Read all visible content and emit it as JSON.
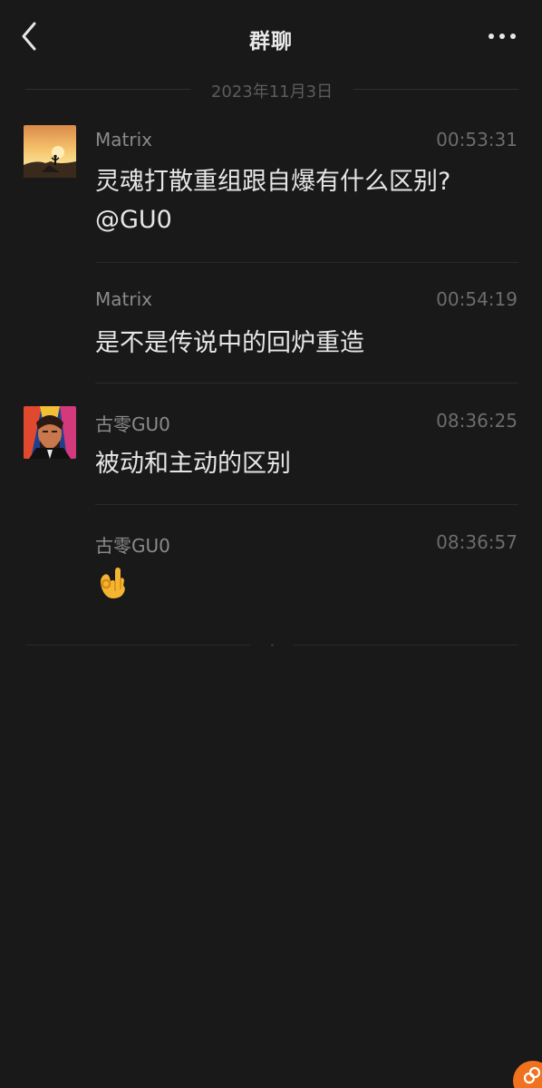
{
  "header": {
    "title": "群聊"
  },
  "date_separator": "2023年11月3日",
  "messages": [
    {
      "sender": "Matrix",
      "time": "00:53:31",
      "text_line1": "灵魂打散重组跟自爆有什么区别?",
      "text_line2": "@GU0",
      "avatar": "sunset-avatar"
    },
    {
      "sender": "Matrix",
      "time": "00:54:19",
      "text": "是不是传说中的回炉重造"
    },
    {
      "sender": "古零GU0",
      "time": "08:36:25",
      "text": "被动和主动的区别",
      "avatar": "colorful-portrait-avatar"
    },
    {
      "sender": "古零GU0",
      "time": "08:36:57",
      "emoji": "ok-hand-emoji"
    }
  ],
  "colors": {
    "background": "#191919",
    "text": "#e6e6e6",
    "meta": "#8a8a8a",
    "accent": "#f0721e"
  }
}
